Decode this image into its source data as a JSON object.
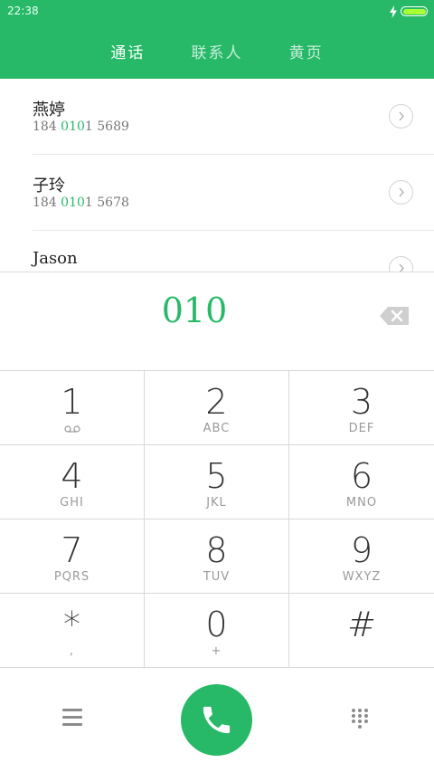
{
  "status_bar": {
    "time": "22:38"
  },
  "tabs": [
    {
      "label": "通话",
      "active": true
    },
    {
      "label": "联系人",
      "active": false
    },
    {
      "label": "黄页",
      "active": false
    }
  ],
  "contacts": [
    {
      "name": "燕婷",
      "number_prefix": "184 ",
      "number_match": "010",
      "number_suffix": "1 5689"
    },
    {
      "name": "子玲",
      "number_prefix": "184 ",
      "number_match": "010",
      "number_suffix": "1 5678"
    },
    {
      "name": "Jason",
      "number_prefix": "",
      "number_match": "",
      "number_suffix": ""
    }
  ],
  "dialer": {
    "input": "010"
  },
  "keypad": [
    {
      "digit": "1",
      "letters": ""
    },
    {
      "digit": "2",
      "letters": "ABC"
    },
    {
      "digit": "3",
      "letters": "DEF"
    },
    {
      "digit": "4",
      "letters": "GHI"
    },
    {
      "digit": "5",
      "letters": "JKL"
    },
    {
      "digit": "6",
      "letters": "MNO"
    },
    {
      "digit": "7",
      "letters": "PQRS"
    },
    {
      "digit": "8",
      "letters": "TUV"
    },
    {
      "digit": "9",
      "letters": "WXYZ"
    },
    {
      "digit": "*",
      "letters": ","
    },
    {
      "digit": "0",
      "letters": "+"
    },
    {
      "digit": "#",
      "letters": ""
    }
  ],
  "colors": {
    "accent": "#27b968",
    "battery": "#a8ff33",
    "text": "#333333",
    "muted": "#9a9a9a"
  },
  "icons": {
    "voicemail": "voicemail-icon",
    "backspace": "backspace-icon",
    "menu": "menu-icon",
    "call": "phone-icon",
    "dialpad": "dialpad-icon",
    "row_arrow": "chevron-right-icon"
  }
}
